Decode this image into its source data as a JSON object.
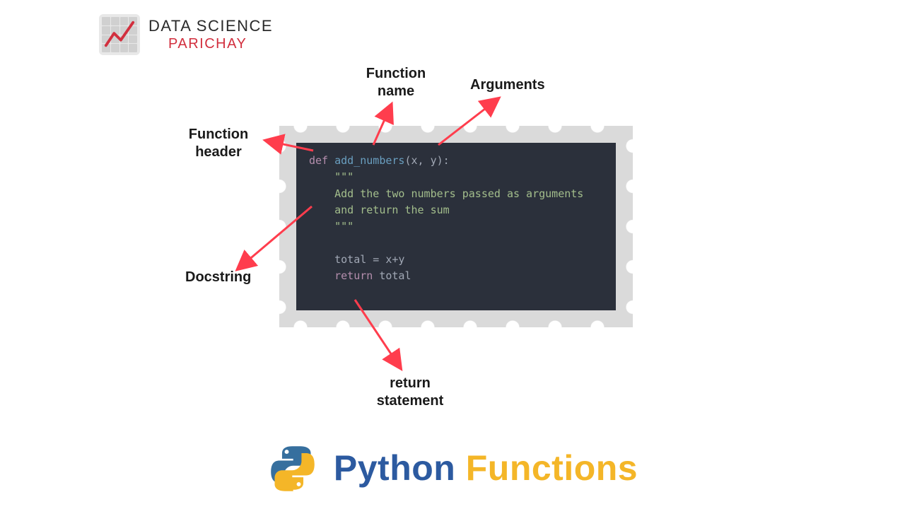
{
  "logo": {
    "line1": "DATA SCIENCE",
    "line2": "PARICHAY"
  },
  "labels": {
    "function_name": "Function\nname",
    "arguments": "Arguments",
    "function_header": "Function\nheader",
    "docstring": "Docstring",
    "return_statement": "return\nstatement"
  },
  "code": {
    "kw_def": "def",
    "fn_name": "add_numbers",
    "params": "(x, y):",
    "doc_open": "\"\"\"",
    "doc_line1": "Add the two numbers passed as arguments",
    "doc_line2": "and return the sum",
    "doc_close": "\"\"\"",
    "assign": "total = x+y",
    "kw_return": "return",
    "ret_val": " total"
  },
  "title": {
    "word1": "Python",
    "word2": "Functions"
  },
  "colors": {
    "accent_red": "#ff3d4d",
    "code_bg": "#2b303b",
    "blue": "#2c5aa0",
    "yellow": "#f4b628"
  }
}
